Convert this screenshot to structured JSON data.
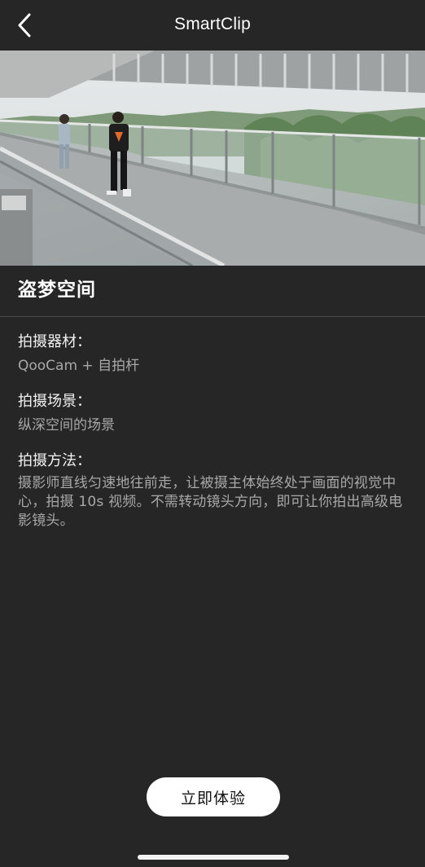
{
  "header": {
    "title": "SmartClip",
    "back_icon": "chevron-left-icon"
  },
  "hero": {
    "description": "photo of a person walking along an elevated walkway with glass railings"
  },
  "content": {
    "title": "盗梦空间",
    "sections": [
      {
        "label": "拍摄器材：",
        "value": "QooCam + 自拍杆"
      },
      {
        "label": "拍摄场景：",
        "value": "纵深空间的场景"
      },
      {
        "label": "拍摄方法：",
        "value": "摄影师直线匀速地往前走，让被摄主体始终处于画面的视觉中心，拍摄 10s 视频。不需转动镜头方向，即可让你拍出高级电影镜头。"
      }
    ]
  },
  "cta": {
    "label": "立即体验"
  },
  "colors": {
    "background": "#262626",
    "text": "#ffffff",
    "muted": "#a8a8a8",
    "button": "#ffffff"
  }
}
